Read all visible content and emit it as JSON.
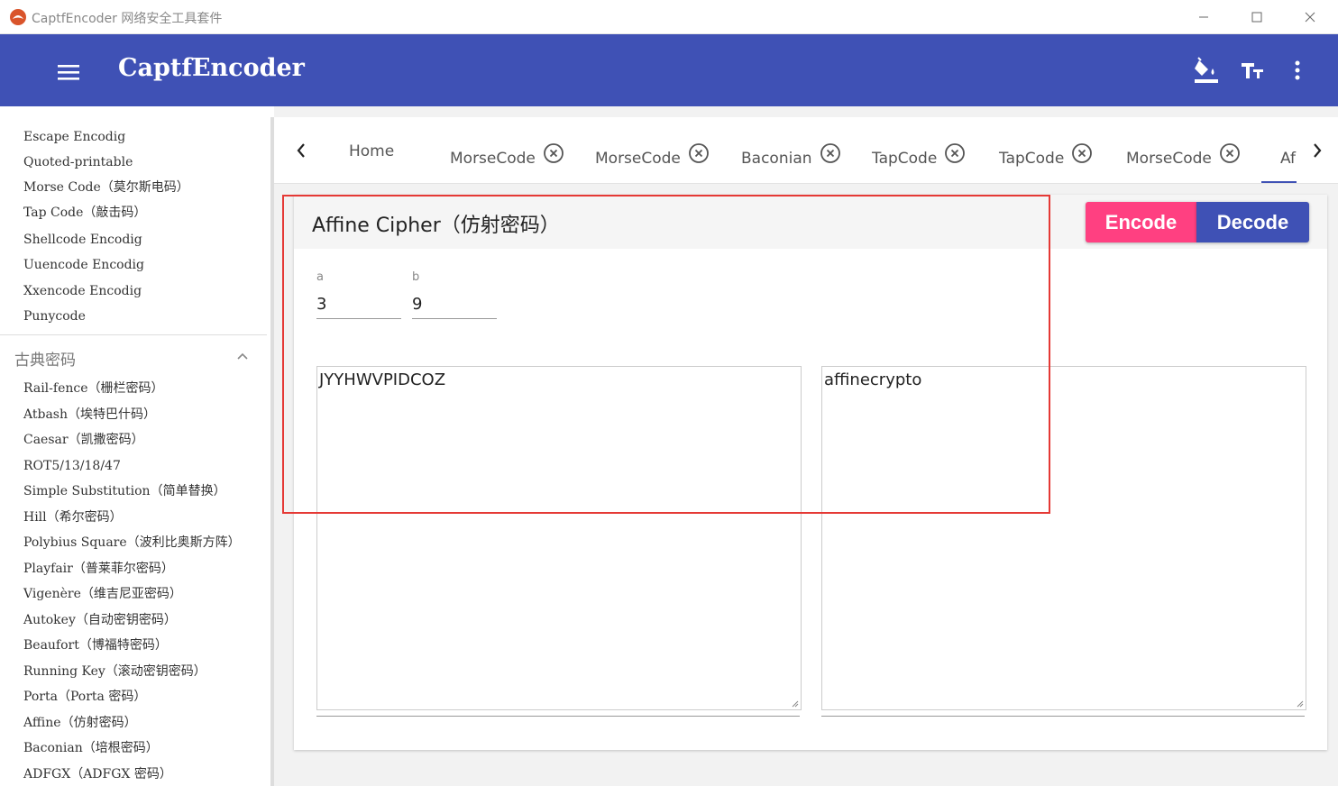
{
  "window": {
    "title": "CaptfEncoder 网络安全工具套件",
    "controls": {
      "minimize": "minimize",
      "maximize": "maximize",
      "close": "close"
    }
  },
  "appbar": {
    "title": "CaptfEncoder",
    "icons": [
      "menu-icon",
      "paint-bucket-icon",
      "text-size-icon",
      "more-vert-icon"
    ]
  },
  "sidebar": {
    "items_top": [
      "Escape Encodig",
      "Quoted-printable",
      "Morse Code（莫尔斯电码）",
      "Tap Code（敲击码）",
      "Shellcode Encodig",
      "Uuencode Encodig",
      "Xxencode Encodig",
      "Punycode"
    ],
    "group_header": "古典密码",
    "items_classic": [
      "Rail-fence（栅栏密码）",
      "Atbash（埃特巴什码）",
      "Caesar（凯撒密码）",
      "ROT5/13/18/47",
      "Simple Substitution（简单替换）",
      "Hill（希尔密码）",
      "Polybius Square（波利比奥斯方阵）",
      "Playfair（普莱菲尔密码）",
      "Vigenère（维吉尼亚密码）",
      "Autokey（自动密钥密码）",
      "Beaufort（博福特密码）",
      "Running Key（滚动密钥密码）",
      "Porta（Porta 密码）",
      "Affine（仿射密码）",
      "Baconian（培根密码）",
      "ADFGX（ADFGX 密码）"
    ]
  },
  "tabs": [
    {
      "label": "Home",
      "closable": false
    },
    {
      "label": "MorseCode",
      "closable": true
    },
    {
      "label": "MorseCode",
      "closable": true
    },
    {
      "label": "Baconian",
      "closable": true
    },
    {
      "label": "TapCode",
      "closable": true
    },
    {
      "label": "TapCode",
      "closable": true
    },
    {
      "label": "MorseCode",
      "closable": true
    },
    {
      "label": "Af",
      "closable": false,
      "active": true
    }
  ],
  "card": {
    "title": "Affine Cipher（仿射密码）",
    "encode_label": "Encode",
    "decode_label": "Decode",
    "param_a": {
      "label": "a",
      "value": "3"
    },
    "param_b": {
      "label": "b",
      "value": "9"
    },
    "input_text": "JYYHWVPIDCOZ",
    "output_text": "affinecrypto"
  },
  "colors": {
    "primary": "#3f51b5",
    "accent": "#ff4081",
    "highlight": "#e53935"
  }
}
